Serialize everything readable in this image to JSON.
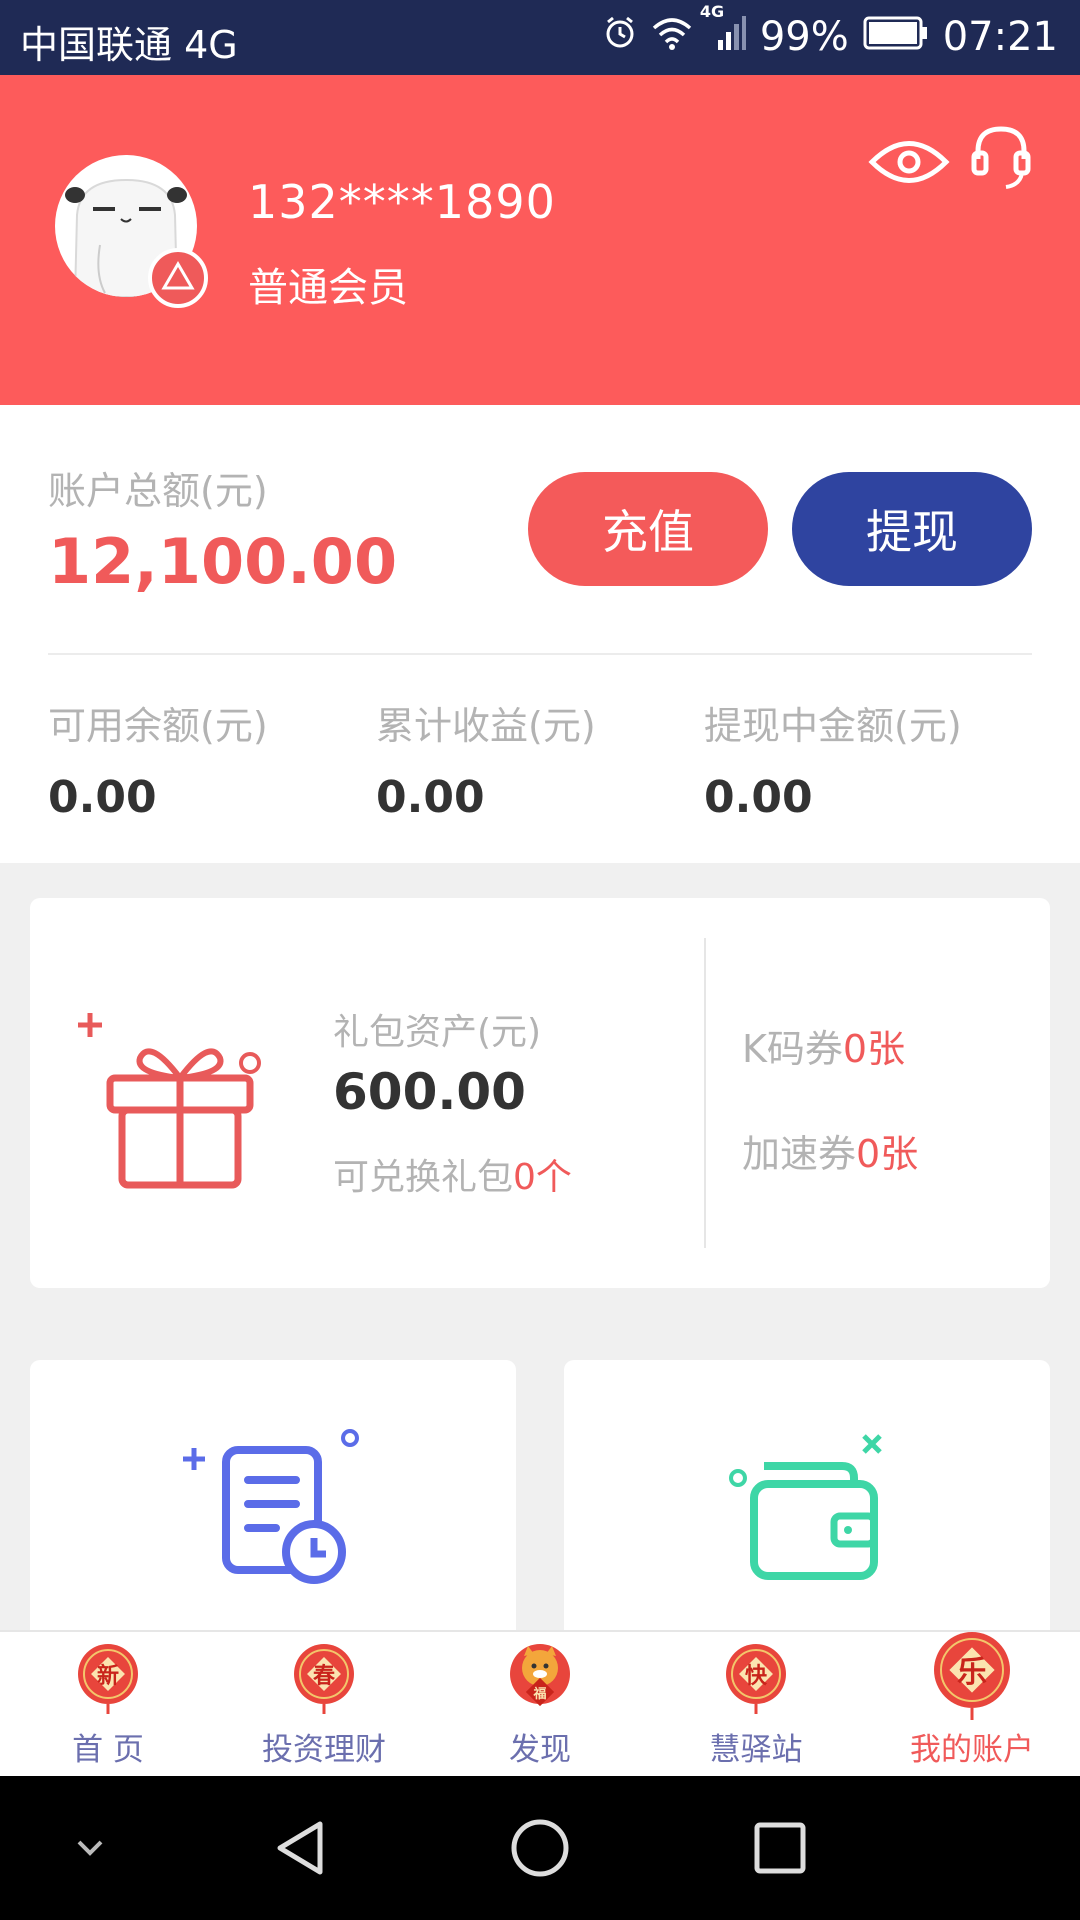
{
  "status_bar": {
    "carrier": "中国联通 4G",
    "network_badge": "4G",
    "battery": "99%",
    "time": "07:21"
  },
  "profile": {
    "phone": "132****1890",
    "member_level": "普通会员"
  },
  "balance": {
    "total_label": "账户总额(元)",
    "total_value": "12,100.00",
    "charge_label": "充值",
    "withdraw_label": "提现",
    "stats": [
      {
        "label": "可用余额(元)",
        "value": "0.00"
      },
      {
        "label": "累计收益(元)",
        "value": "0.00"
      },
      {
        "label": "提现中金额(元)",
        "value": "0.00"
      }
    ]
  },
  "gift": {
    "label": "礼包资产(元)",
    "value": "600.00",
    "exchange_prefix": "可兑换礼包",
    "exchange_count": "0个",
    "coupons": [
      {
        "prefix": "K码券",
        "count": "0张"
      },
      {
        "prefix": "加速券",
        "count": "0张"
      }
    ]
  },
  "tabs": [
    {
      "label": "首 页",
      "icon_char": "新"
    },
    {
      "label": "投资理财",
      "icon_char": "春"
    },
    {
      "label": "发现",
      "icon_char": "福"
    },
    {
      "label": "慧驿站",
      "icon_char": "快"
    },
    {
      "label": "我的账户",
      "icon_char": "乐"
    }
  ],
  "colors": {
    "header": "#fd5b5b",
    "accent_red": "#f05a5a",
    "navy": "#2f44a0",
    "purple_blue": "#5b6ce8",
    "green": "#3ed6a6"
  }
}
